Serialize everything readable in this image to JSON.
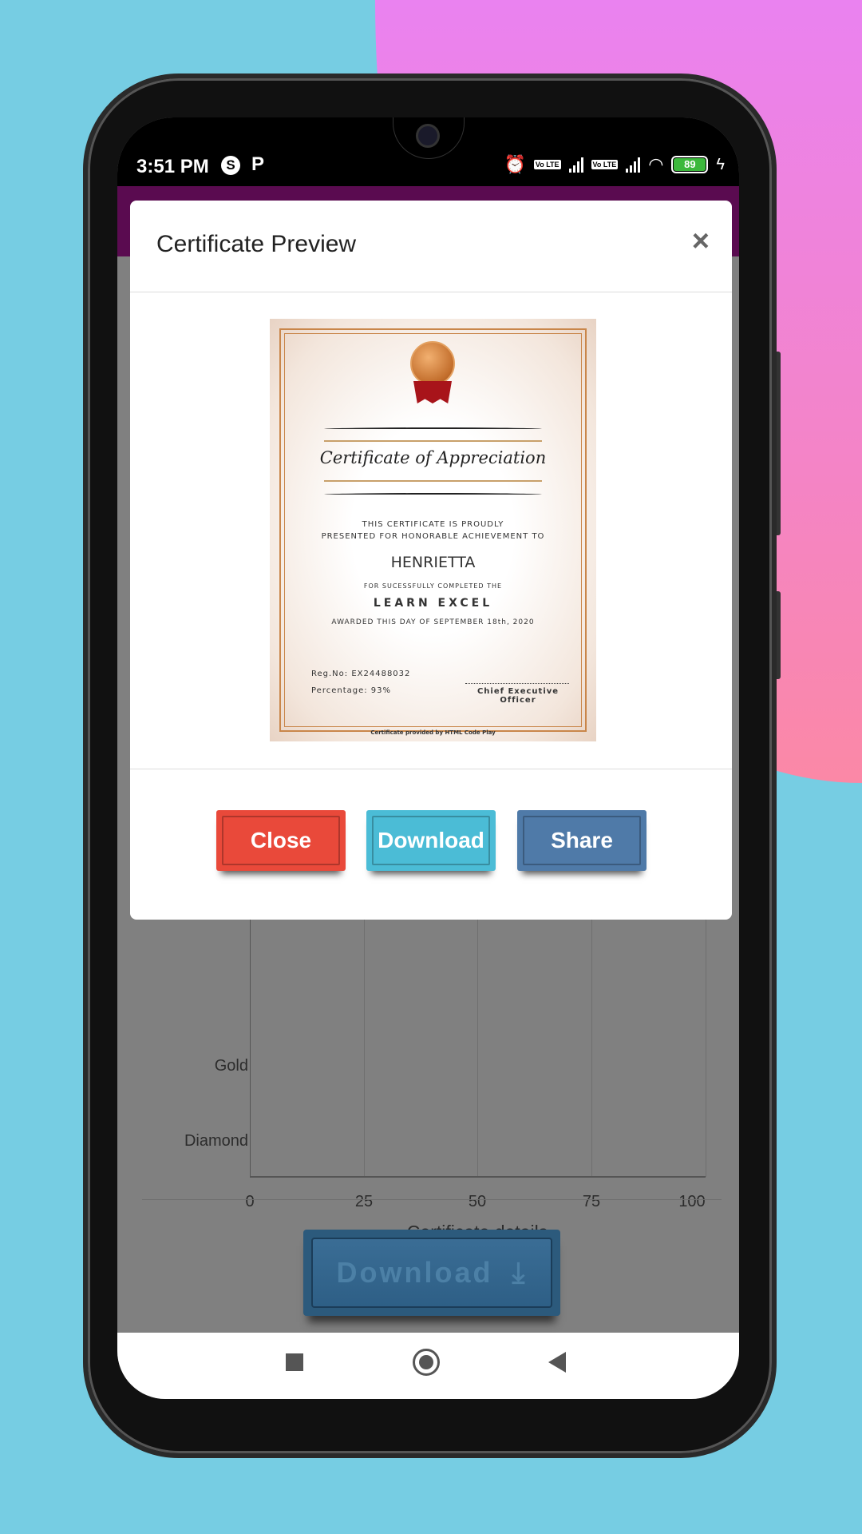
{
  "status_bar": {
    "time": "3:51 PM",
    "app_icons": [
      "skype-icon",
      "p-icon"
    ],
    "battery": "89",
    "icons": [
      "alarm-icon",
      "volte-icon",
      "signal-icon",
      "volte-icon",
      "signal-icon",
      "wifi-icon",
      "battery-icon",
      "charging-icon"
    ],
    "volte_text": "Vo LTE"
  },
  "modal": {
    "title": "Certificate Preview",
    "close_symbol": "×",
    "certificate": {
      "heading": "Certificate of Appreciation",
      "line1": "THIS CERTIFICATE IS PROUDLY",
      "line2": "PRESENTED FOR HONORABLE ACHIEVEMENT TO",
      "name": "HENRIETTA",
      "line3": "FOR SUCESSFULLY COMPLETED THE",
      "course": "LEARN EXCEL",
      "awarded": "AWARDED THIS DAY OF  SEPTEMBER 18th, 2020",
      "reg_no": "Reg.No: EX24488032",
      "percentage": "Percentage: 93%",
      "signatory": "Chief Executive Officer",
      "footer": "Certificate provided by HTML Code Play"
    },
    "buttons": {
      "close": "Close",
      "download": "Download",
      "share": "Share"
    },
    "colors": {
      "close": "#e9493a",
      "download": "#4bbcd6",
      "share": "#4f7aa8"
    }
  },
  "chart_data": {
    "type": "bar",
    "orientation": "horizontal",
    "categories": [
      "Gold",
      "Diamond"
    ],
    "xticks": [
      "0",
      "25",
      "50",
      "75",
      "100"
    ],
    "xlim": [
      0,
      100
    ],
    "xlabel": "Certificate details",
    "grid": true
  },
  "main": {
    "download_label": "Download"
  },
  "colors": {
    "appbar": "#5a0b50",
    "overlay": "#808080",
    "background": "#76cde3"
  }
}
